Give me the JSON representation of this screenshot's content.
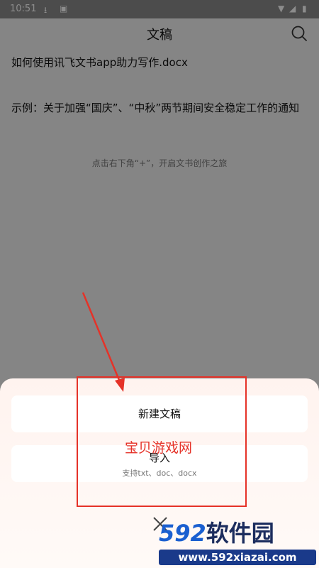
{
  "status_bar": {
    "time": "10:51"
  },
  "header": {
    "title": "文稿"
  },
  "documents": [
    {
      "title": "如何使用讯飞文书app助力写作.docx"
    },
    {
      "title": "示例：关于加强“国庆”、“中秋”两节期间安全稳定工作的通知"
    }
  ],
  "hint": "点击右下角“+”，开启文书创作之旅",
  "sheet": {
    "new_label": "新建文稿",
    "import_label": "导入",
    "import_sub": "支持txt、doc、docx"
  },
  "watermark": "宝贝游戏网",
  "logo": {
    "num": "592",
    "cn": "软件园",
    "url": "www.592xiazai.com"
  },
  "colors": {
    "annotation": "#e53228",
    "logo_blue": "#1a5fd0"
  }
}
